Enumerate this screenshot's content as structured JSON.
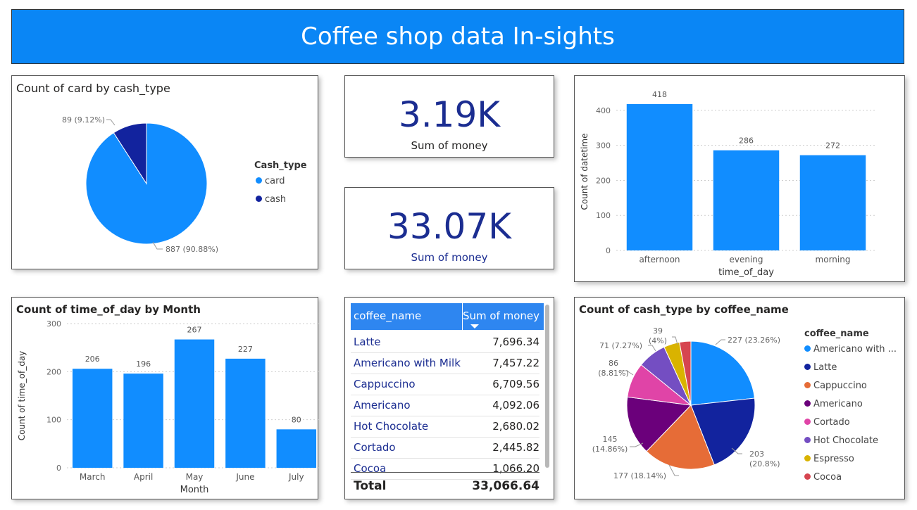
{
  "header": {
    "title": "Coffee shop data In-sights"
  },
  "pie_cash": {
    "title": "Count of card by cash_type",
    "legend_title": "Cash_type",
    "legend": [
      {
        "label": "card",
        "color": "#118dff"
      },
      {
        "label": "cash",
        "color": "#12239e"
      }
    ],
    "labels": {
      "cash": "89 (9.12%)",
      "card": "887 (90.88%)"
    }
  },
  "kpi1": {
    "value": "3.19K",
    "label": "Sum of money"
  },
  "kpi2": {
    "value": "33.07K",
    "label": "Sum of money"
  },
  "table": {
    "headers": [
      "coffee_name",
      "Sum of money"
    ],
    "rows": [
      {
        "name": "Latte",
        "value": "7,696.34"
      },
      {
        "name": "Americano with Milk",
        "value": "7,457.22"
      },
      {
        "name": "Cappuccino",
        "value": "6,709.56"
      },
      {
        "name": "Americano",
        "value": "4,092.06"
      },
      {
        "name": "Hot Chocolate",
        "value": "2,680.02"
      },
      {
        "name": "Cortado",
        "value": "2,445.82"
      },
      {
        "name": "Cocoa",
        "value": "1,066.20"
      }
    ],
    "total_label": "Total",
    "total_value": "33,066.64"
  },
  "chart_data": [
    {
      "type": "pie",
      "title": "Count of card by cash_type",
      "categories": [
        "card",
        "cash"
      ],
      "values": [
        887,
        89
      ],
      "percent": [
        90.88,
        9.12
      ],
      "legend_title": "Cash_type",
      "legend_position": "right"
    },
    {
      "type": "bar",
      "title": "",
      "categories": [
        "afternoon",
        "evening",
        "morning"
      ],
      "values": [
        418,
        286,
        272
      ],
      "xlabel": "time_of_day",
      "ylabel": "Count of datetime",
      "yticks": [
        0,
        100,
        200,
        300,
        400
      ],
      "ylim": [
        0,
        450
      ],
      "color": "#118dff",
      "grid": true
    },
    {
      "type": "bar",
      "title": "Count of time_of_day by Month",
      "categories": [
        "March",
        "April",
        "May",
        "June",
        "July"
      ],
      "values": [
        206,
        196,
        267,
        227,
        80
      ],
      "xlabel": "Month",
      "ylabel": "Count of time_of_day",
      "yticks": [
        0,
        100,
        200,
        300
      ],
      "ylim": [
        0,
        300
      ],
      "color": "#118dff",
      "grid": true
    },
    {
      "type": "pie",
      "title": "Count of cash_type by coffee_name",
      "legend_title": "coffee_name",
      "legend_position": "right",
      "categories": [
        "Americano with Milk",
        "Latte",
        "Cappuccino",
        "Americano",
        "Cortado",
        "Hot Chocolate",
        "Espresso",
        "Cocoa"
      ],
      "legend_labels": [
        "Americano with ...",
        "Latte",
        "Cappuccino",
        "Americano",
        "Cortado",
        "Hot Chocolate",
        "Espresso",
        "Cocoa"
      ],
      "values": [
        227,
        203,
        177,
        145,
        86,
        71,
        39,
        28
      ],
      "percent": [
        23.26,
        20.8,
        18.14,
        14.86,
        8.81,
        7.27,
        4,
        2.87
      ],
      "colors": [
        "#118dff",
        "#12239e",
        "#e66c37",
        "#6b007b",
        "#e044a7",
        "#744ec2",
        "#d9b300",
        "#d64550"
      ],
      "data_labels": {
        "Americano with Milk": "227 (23.26%)",
        "Latte": [
          "203",
          "(20.8%)"
        ],
        "Cappuccino": "177 (18.14%)",
        "Americano": [
          "145",
          "(14.86%)"
        ],
        "Cortado": [
          "86",
          "(8.81%)"
        ],
        "Hot Chocolate": "71 (7.27%)",
        "Espresso": [
          "39",
          "(4%)"
        ]
      }
    }
  ]
}
